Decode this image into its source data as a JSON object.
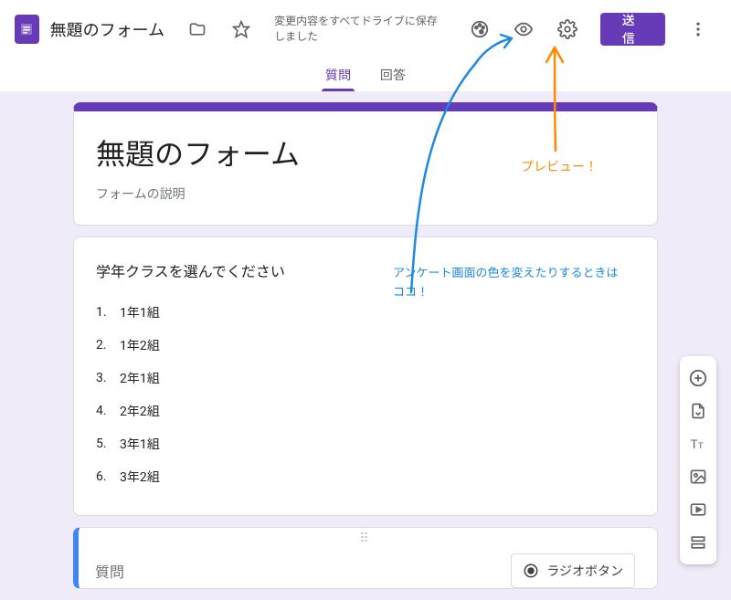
{
  "header": {
    "docTitle": "無題のフォーム",
    "saveStatus": "変更内容をすべてドライブに保存しました",
    "sendLabel": "送信"
  },
  "tabs": {
    "questions": "質問",
    "responses": "回答"
  },
  "form": {
    "title": "無題のフォーム",
    "description": "フォームの説明"
  },
  "question1": {
    "title": "学年クラスを選んでください",
    "options": [
      "1年1組",
      "1年2組",
      "2年1組",
      "2年2組",
      "3年1組",
      "3年2組"
    ]
  },
  "editing": {
    "questionLabel": "質問",
    "typeLabel": "ラジオボタン"
  },
  "annotations": {
    "preview": "プレビュー！",
    "themeLine1": "アンケート画面の色を変えたりするときは",
    "themeLine2": "ココ！"
  }
}
